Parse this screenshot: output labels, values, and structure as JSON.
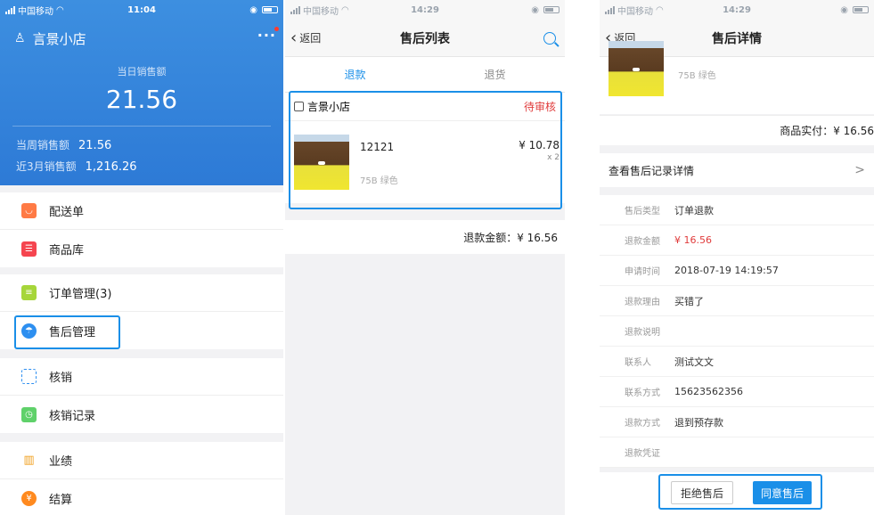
{
  "colors": {
    "primary": "#2d7ad6",
    "highlight": "#1a8fe8",
    "pending": "#e03c3c"
  },
  "phone1": {
    "status": {
      "carrier": "中国移动",
      "time": "11:04"
    },
    "shop_name": "言景小店",
    "today_sales_label": "当日销售额",
    "today_sales_value": "21.56",
    "week_sales_label": "当周销售额",
    "week_sales_value": "21.56",
    "three_month_label": "近3月销售额",
    "three_month_value": "1,216.26",
    "menu": [
      {
        "label": "配送单",
        "icon": "box-icon"
      },
      {
        "label": "商品库",
        "icon": "database-icon"
      },
      {
        "label": "订单管理(3)",
        "icon": "document-icon"
      },
      {
        "label": "售后管理",
        "icon": "umbrella-icon"
      },
      {
        "label": "核销",
        "icon": "scan-icon"
      },
      {
        "label": "核销记录",
        "icon": "clock-icon"
      },
      {
        "label": "业绩",
        "icon": "bar-chart-icon"
      },
      {
        "label": "结算",
        "icon": "yen-icon"
      }
    ]
  },
  "phone2": {
    "status": {
      "carrier": "中国移动",
      "time": "14:29"
    },
    "back_label": "返回",
    "title": "售后列表",
    "tabs": [
      "退款",
      "退货"
    ],
    "order": {
      "shop_name": "言景小店",
      "status": "待审核",
      "product_name": "12121",
      "price": "¥ 10.78",
      "qty": "x 2",
      "spec": "75B  绿色"
    },
    "refund_amount": "退款金额：¥ 16.56"
  },
  "phone3": {
    "status": {
      "carrier": "中国移动",
      "time": "14:29"
    },
    "back_label": "返回",
    "title": "售后详情",
    "spec": "75B  绿色",
    "paid": "商品实付：¥ 16.56",
    "record_link": "查看售后记录详情",
    "details": [
      {
        "key": "售后类型",
        "value": "订单退款",
        "style": ""
      },
      {
        "key": "退款金额",
        "value": "¥ 16.56",
        "style": "red"
      },
      {
        "key": "申请时间",
        "value": "2018-07-19 14:19:57",
        "style": ""
      },
      {
        "key": "退款理由",
        "value": "买错了",
        "style": ""
      },
      {
        "key": "退款说明",
        "value": "",
        "style": ""
      },
      {
        "key": "联系人",
        "value": "测试文文",
        "style": ""
      },
      {
        "key": "联系方式",
        "value": "15623562356",
        "style": ""
      },
      {
        "key": "退款方式",
        "value": "退到预存款",
        "style": ""
      },
      {
        "key": "退款凭证",
        "value": "",
        "style": ""
      }
    ],
    "reject_label": "拒绝售后",
    "agree_label": "同意售后"
  }
}
